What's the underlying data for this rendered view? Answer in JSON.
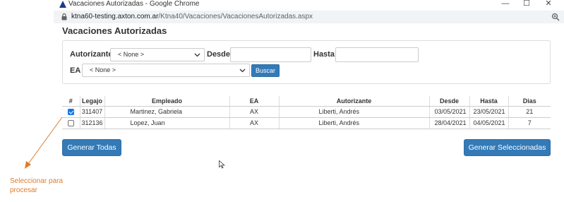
{
  "browser": {
    "window_title": "Vacaciones Autorizadas - Google Chrome",
    "url_host": "ktna60-testing.axton.com.ar",
    "url_path": "/Ktna40/Vacaciones/VacacionesAutorizadas.aspx",
    "controls": {
      "minimize": "—",
      "maximize": "☐",
      "close": "✕"
    }
  },
  "page": {
    "title": "Vacaciones Autorizadas"
  },
  "filters": {
    "autorizante_label": "Autorizante",
    "autorizante_value": "< None >",
    "desde_label": "Desde",
    "desde_value": "",
    "hasta_label": "Hasta",
    "hasta_value": "",
    "ea_label": "EA",
    "ea_value": "< None >",
    "search_label": "Buscar"
  },
  "table": {
    "headers": [
      "#",
      "Legajo",
      "Empleado",
      "EA",
      "Autorizante",
      "Desde",
      "Hasta",
      "Dias"
    ],
    "rows": [
      {
        "checked": true,
        "legajo": "311407",
        "empleado": "Martinez, Gabriela",
        "ea": "AX",
        "autorizante": "Liberti, Andrés",
        "desde": "03/05/2021",
        "hasta": "23/05/2021",
        "dias": "21"
      },
      {
        "checked": false,
        "legajo": "312136",
        "empleado": "Lopez, Juan",
        "ea": "AX",
        "autorizante": "Liberti, Andrés",
        "desde": "28/04/2021",
        "hasta": "04/05/2021",
        "dias": "7"
      }
    ]
  },
  "actions": {
    "generate_all": "Generar Todas",
    "generate_selected": "Generar Seleccionadas"
  },
  "annotation": {
    "text": "Seleccionar para procesar",
    "color": "#e07b2a"
  },
  "colors": {
    "primary": "#337ab7",
    "checkbox": "#1a73e8"
  }
}
